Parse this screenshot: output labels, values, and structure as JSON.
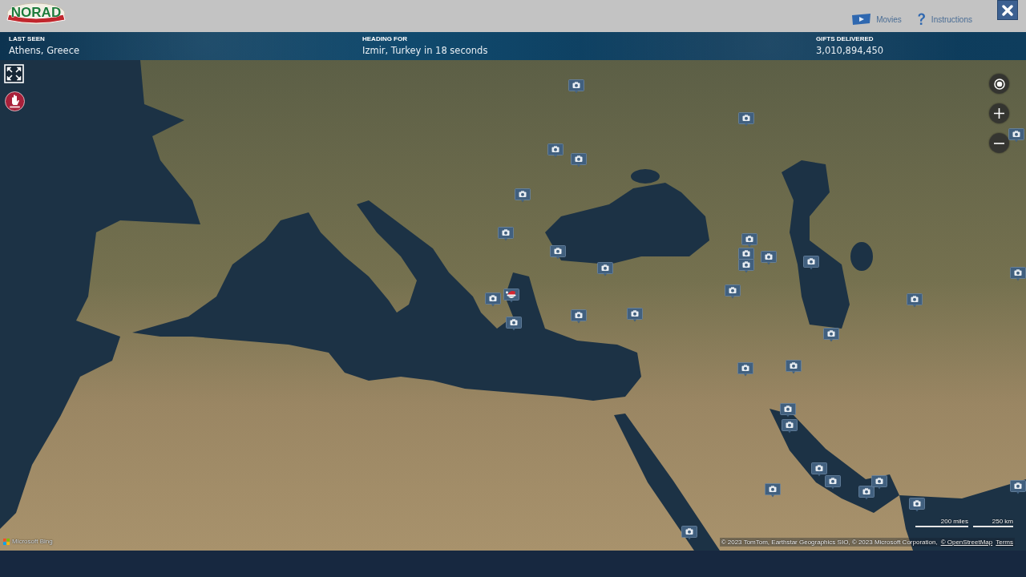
{
  "top_bar": {
    "logo": "NORAD",
    "links": [
      {
        "label": "Movies",
        "kind": "movies"
      },
      {
        "label": "Instructions",
        "kind": "help"
      }
    ]
  },
  "stats": [
    {
      "label": "LAST SEEN",
      "value": "Athens, Greece"
    },
    {
      "label": "HEADING FOR",
      "value": "Izmir, Turkey in 18 seconds"
    },
    {
      "label": "GIFTS DELIVERED",
      "value": "3,010,894,450"
    }
  ],
  "map": {
    "scale": [
      "200 miles",
      "250 km"
    ],
    "attribution": "© 2023 TomTom, Earthstar Geographics SIO, © 2023 Microsoft Corporation,",
    "attribution_links": [
      "© OpenStreetMap",
      "Terms"
    ],
    "provider_logo": "Microsoft Bing"
  }
}
